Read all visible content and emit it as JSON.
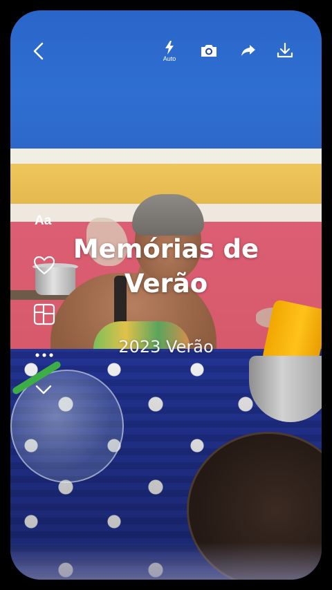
{
  "toolbar": {
    "flash_mode_label": "Auto",
    "icons": [
      "back-arrow-icon",
      "flash-icon",
      "camera-icon",
      "share-icon",
      "download-icon"
    ]
  },
  "side_tools": {
    "text_label": "Aa",
    "icons": [
      "text-style-icon",
      "heart-icon",
      "layout-icon",
      "more-icon",
      "chevron-down-icon"
    ]
  },
  "memory": {
    "title": "Memórias de Verão",
    "subtitle": "2023 Verão"
  },
  "colors": {
    "overlay_text": "#ffffff",
    "background": "#000000"
  }
}
